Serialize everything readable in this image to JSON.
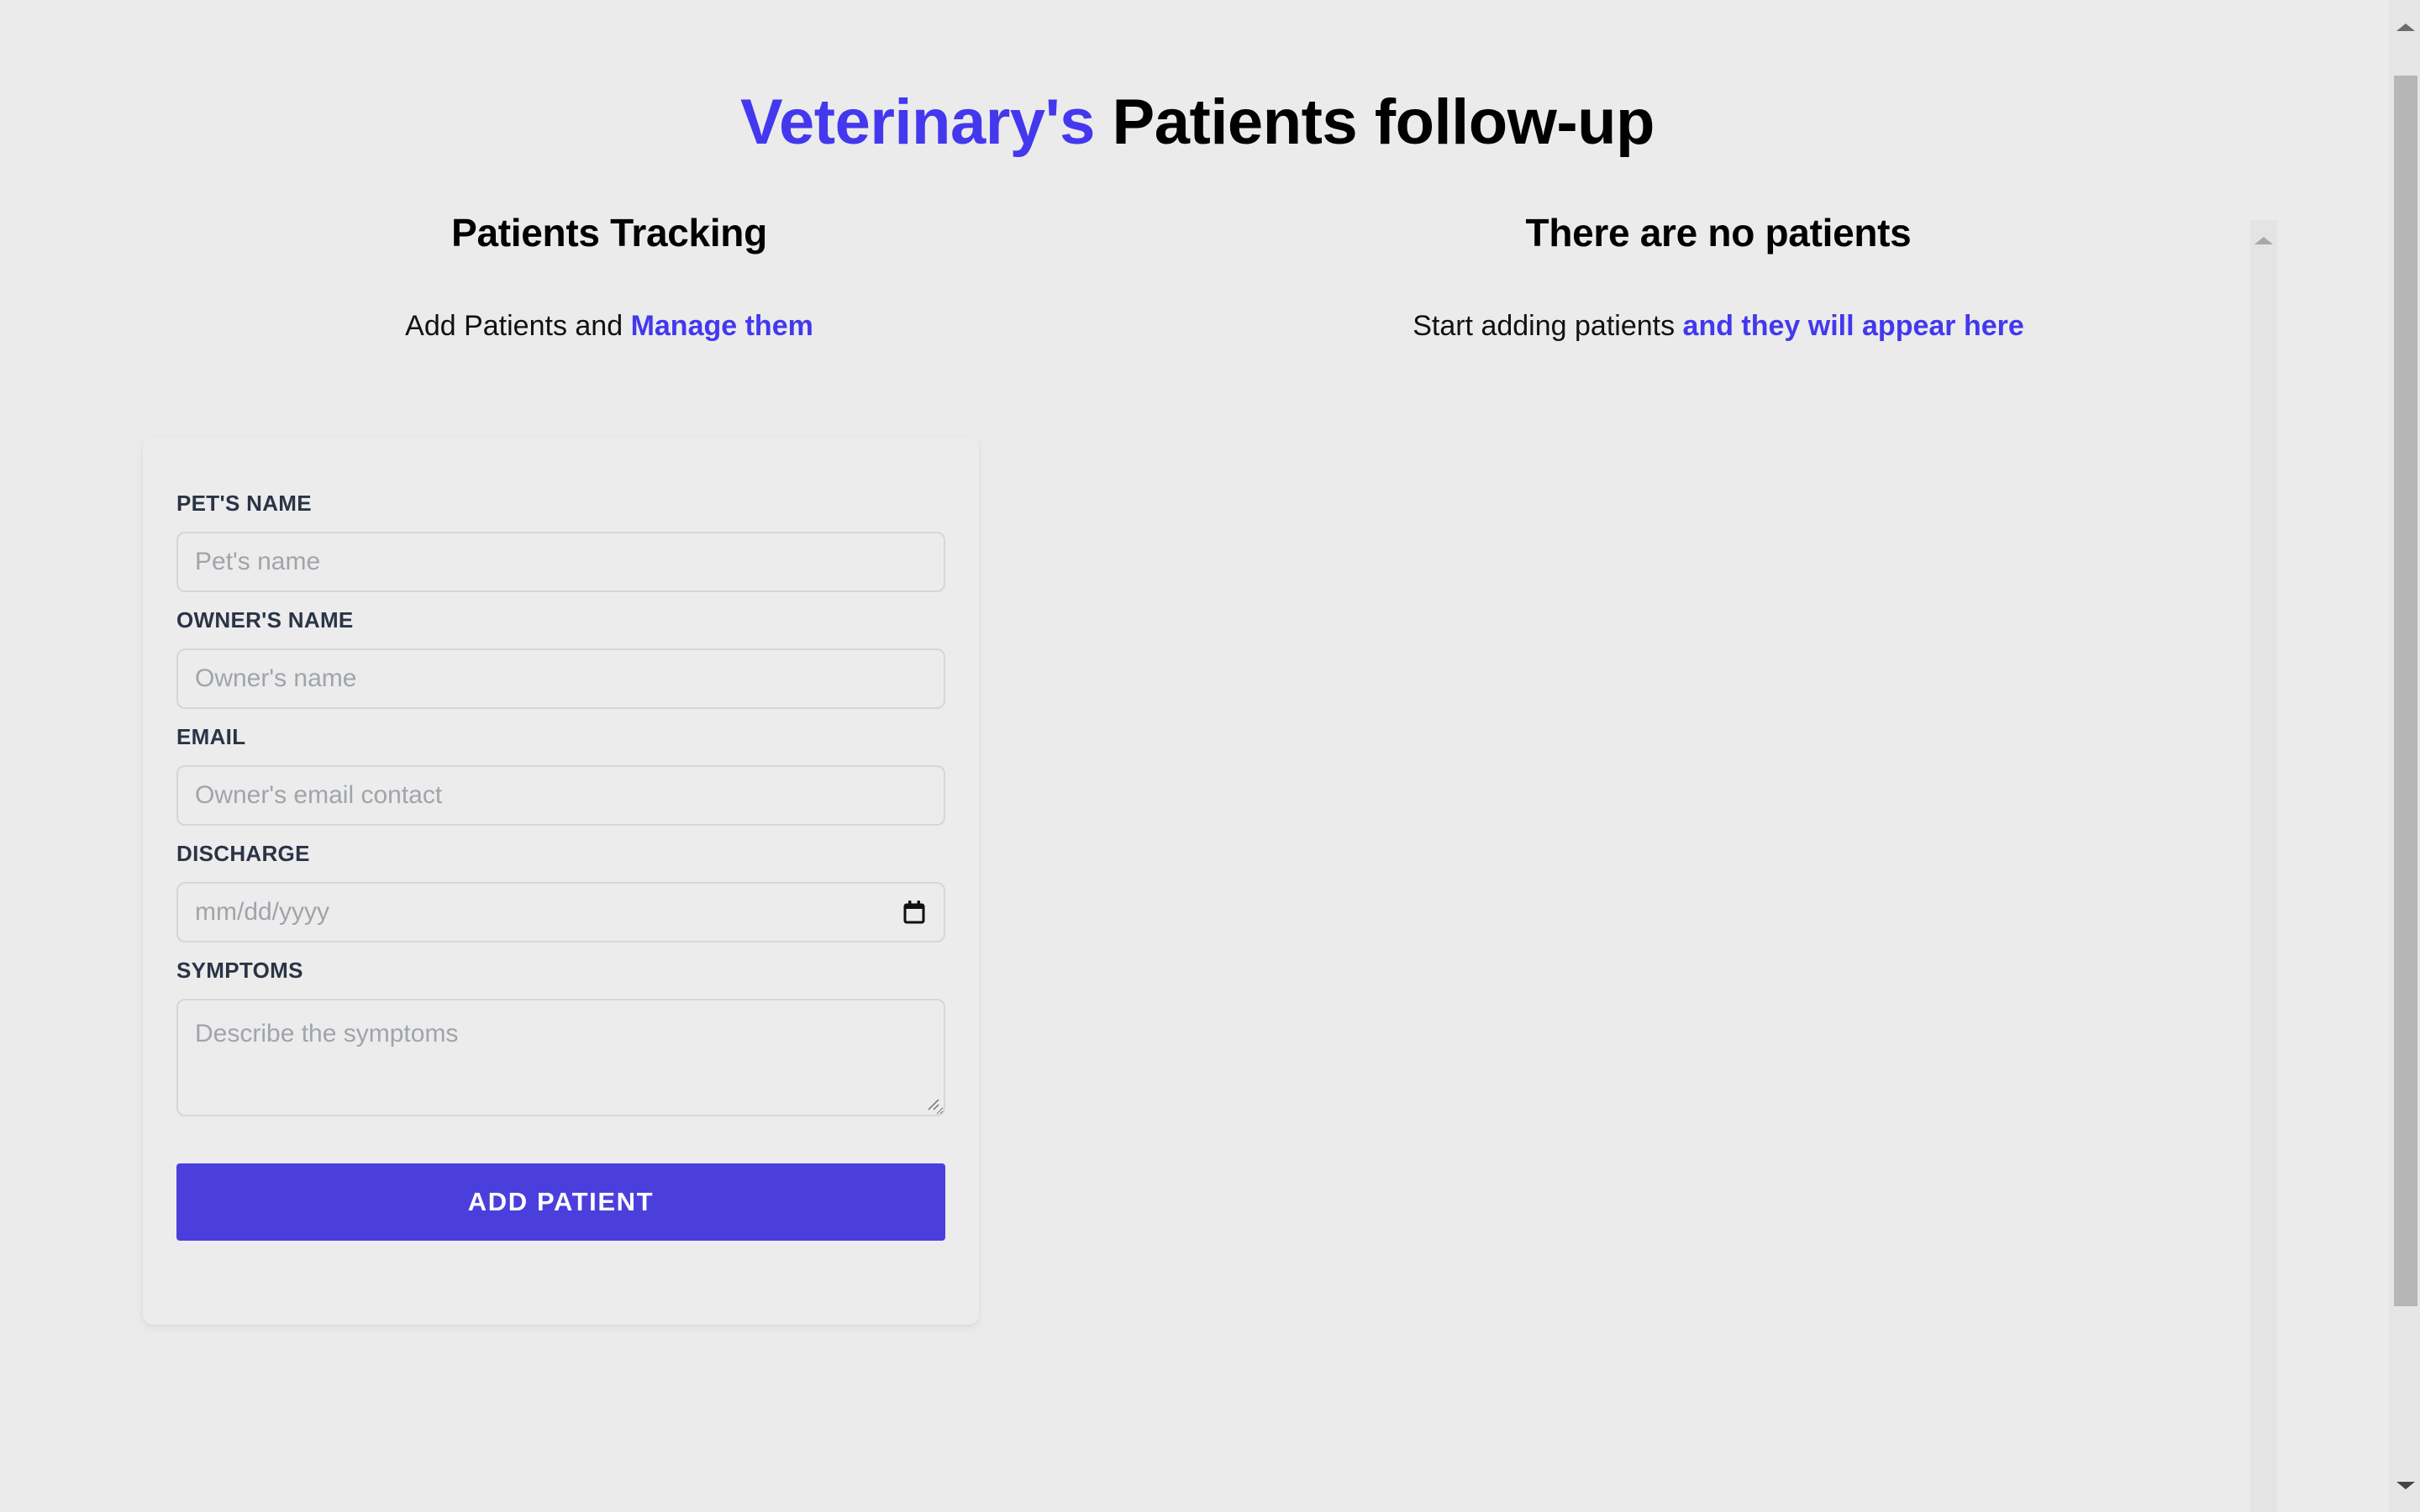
{
  "app": {
    "title_accent": "Veterinary's",
    "title_rest": "Patients follow-up"
  },
  "theme": {
    "accent": "#4338ee",
    "button": "#4a3fdd",
    "page_bg": "#ebebeb",
    "label": "#2b3446",
    "placeholder": "#a0a4ab",
    "input_border": "#d6d6da"
  },
  "left_column": {
    "heading": "Patients Tracking",
    "sub_prefix": "Add Patients and ",
    "sub_highlight": "Manage them"
  },
  "right_column": {
    "heading": "There are no patients",
    "sub_prefix": "Start adding patients ",
    "sub_highlight": "and they will appear here"
  },
  "form": {
    "fields": [
      {
        "name": "pet-name",
        "label": "PET'S NAME",
        "placeholder": "Pet's name",
        "value": "",
        "type": "text"
      },
      {
        "name": "owner-name",
        "label": "OWNER'S NAME",
        "placeholder": "Owner's name",
        "value": "",
        "type": "text"
      },
      {
        "name": "email",
        "label": "EMAIL",
        "placeholder": "Owner's email contact",
        "value": "",
        "type": "email"
      },
      {
        "name": "discharge",
        "label": "DISCHARGE",
        "placeholder": "mm/dd/yyyy",
        "value": "",
        "type": "date"
      },
      {
        "name": "symptoms",
        "label": "SYMPTOMS",
        "placeholder": "Describe the symptoms",
        "value": "",
        "type": "textarea"
      }
    ],
    "submit_label": "ADD PATIENT"
  },
  "icons": {
    "calendar": "calendar-icon",
    "resize": "resize-handle-icon",
    "scroll_up": "scroll-up-arrow-icon",
    "scroll_down": "scroll-down-arrow-icon"
  }
}
